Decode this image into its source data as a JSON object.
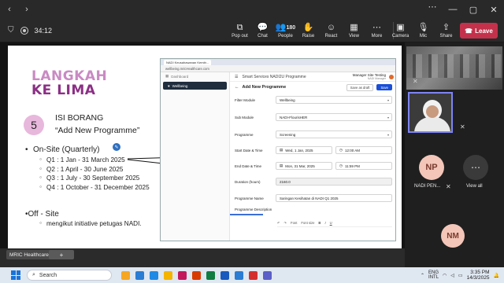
{
  "titlebar": {
    "window_controls": [
      "minimize-icon",
      "maximize-icon",
      "close-icon"
    ]
  },
  "meeting": {
    "timer": "34:12",
    "tools": [
      {
        "name": "pop-out",
        "label": "Pop out",
        "glyph": "⧉"
      },
      {
        "name": "chat",
        "label": "Chat",
        "glyph": "💬"
      },
      {
        "name": "people",
        "label": "People",
        "glyph": "👥",
        "count": "180"
      },
      {
        "name": "raise",
        "label": "Raise",
        "glyph": "✋"
      },
      {
        "name": "react",
        "label": "React",
        "glyph": "☺"
      },
      {
        "name": "view",
        "label": "View",
        "glyph": "▦"
      },
      {
        "name": "more",
        "label": "More",
        "glyph": "⋯"
      }
    ],
    "devices": [
      {
        "name": "camera",
        "label": "Camera",
        "glyph": "▣"
      },
      {
        "name": "mic",
        "label": "Mic",
        "glyph": "🎙"
      },
      {
        "name": "share",
        "label": "Share",
        "glyph": "⇪"
      }
    ],
    "leave_label": "Leave"
  },
  "slide": {
    "title_line1": "LANGKAH",
    "title_line2": "KE LIMA",
    "step_number": "5",
    "heading_line1": "ISI BORANG",
    "heading_line2": "“Add New Programme”",
    "onsite_label": "On-Site (Quarterly)",
    "quarters": [
      "Q1 : 1 Jan - 31 March 2025",
      "Q2 : 1 April - 30 June 2025",
      "Q3 : 1 July -  30 September 2025",
      "Q4 : 1 October - 31 December 2025"
    ],
    "offsite_label": "Off - Site",
    "offsite_sub": "mengikut initiative petugas NADI."
  },
  "browser": {
    "tab_title": "NADI Keusahawanan Kemitr...",
    "url": "wellbeing.mricHealthcare.com",
    "sidebar": {
      "dashboard": "Dashboard",
      "wellbeing": "Wellbeing"
    },
    "header_title": "Smart Services NADI2U Programme",
    "user_name": "Manager Site Testing",
    "user_role": "NADI Manager",
    "page_title": "Add New Programme",
    "save_draft": "Save as draft",
    "save": "Save",
    "form": {
      "filter_module_label": "Filter Module",
      "filter_module": "Wellbeing",
      "sub_module_label": "Sub Module",
      "sub_module": "NADI-FlourisHER",
      "programme_label": "Programme",
      "programme": "Screening",
      "start_label": "Start Date & Time",
      "start_date": "Wed, 1 Jan, 2025",
      "start_time": "12:00 AM",
      "end_label": "End Date & Time",
      "end_date": "Mon, 31 Mar, 2025",
      "end_time": "11:59 PM",
      "duration_label": "Duration (hours)",
      "duration": "2160.0",
      "name_label": "Programme Name",
      "name": "Saringan Kesihatan di NADI Q1 2025",
      "desc_label": "Programme Description",
      "editor_font": "Font",
      "editor_size": "Font size"
    }
  },
  "participants": {
    "np_initials": "NP",
    "np_label": "NADI PEN...",
    "view_all": "View all",
    "nm_initials": "NM"
  },
  "bottom": {
    "tab_label": "MRIC Healthcare",
    "add": "+"
  },
  "taskbar": {
    "search_placeholder": "Search",
    "lang_line1": "ENG",
    "lang_line2": "INTL",
    "time": "3:35 PM",
    "date": "14/3/2025",
    "app_colors": [
      "#f5a623",
      "#2b7cd3",
      "#1e88e5",
      "#f4b400",
      "#c2185b",
      "#d83b01",
      "#107c41",
      "#185abd",
      "#2b7cd3",
      "#d32f2f",
      "#5b5fc7"
    ]
  }
}
